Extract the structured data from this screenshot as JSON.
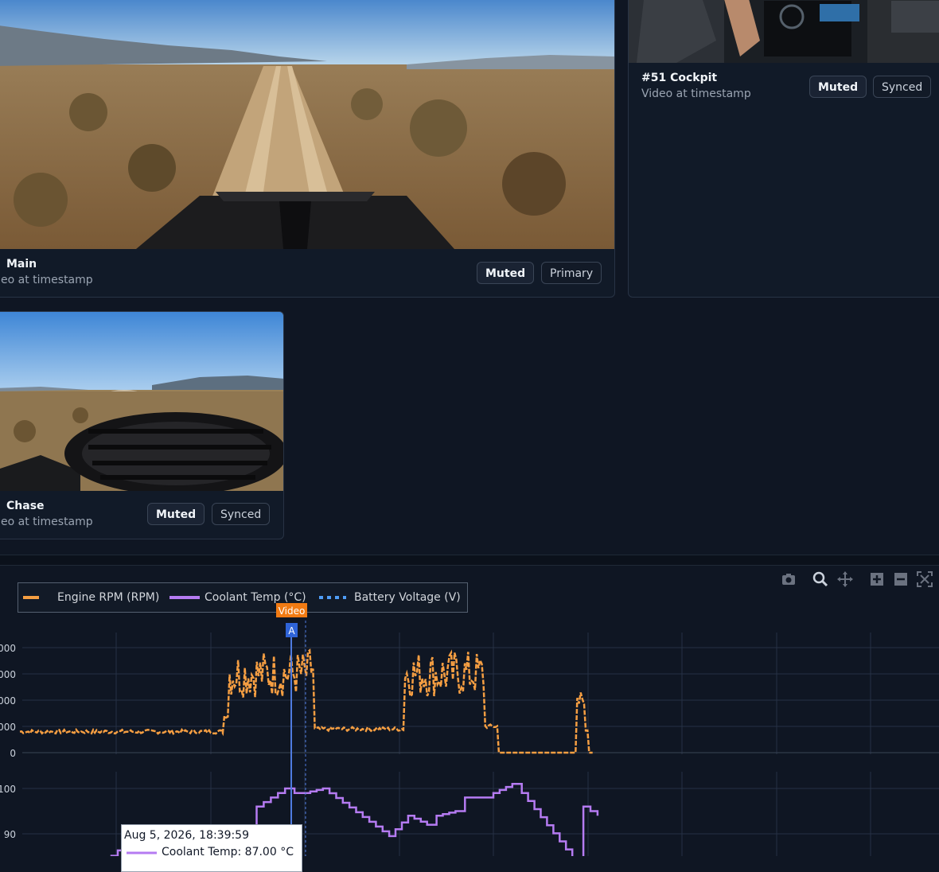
{
  "cameras": [
    {
      "title": "Main",
      "subtitle": "eo at timestamp",
      "badges": [
        "Muted",
        "Primary"
      ]
    },
    {
      "title": "#51 Cockpit",
      "subtitle": "Video at timestamp",
      "badges": [
        "Muted",
        "Synced"
      ]
    },
    {
      "title": "Chase",
      "subtitle": "eo at timestamp",
      "badges": [
        "Muted",
        "Synced"
      ]
    }
  ],
  "chart": {
    "legend": [
      {
        "name": "Engine RPM (RPM)",
        "color": "#f59e42",
        "style": "dashed"
      },
      {
        "name": "Coolant Temp (°C)",
        "color": "#b57bf2",
        "style": "solid"
      },
      {
        "name": "Battery Voltage (V)",
        "color": "#4f9cf5",
        "style": "dotted"
      }
    ],
    "video_marker_label": "Video",
    "cursor_marker_label": "A",
    "toolbar_icons": [
      "camera-icon",
      "zoom-icon",
      "pan-icon",
      "zoom-in-icon",
      "zoom-out-icon",
      "reset-axes-icon"
    ],
    "tooltip": {
      "time": "Aug 5, 2026, 18:39:59",
      "series": "Coolant Temp: 87.00 °C"
    }
  },
  "chart_data": [
    {
      "type": "line",
      "series": [
        {
          "name": "Engine RPM (RPM)",
          "color": "#f59e42"
        }
      ],
      "ytick_labels": [
        "000",
        "000",
        "000",
        "000",
        "0"
      ],
      "y_ticks": [
        4,
        3,
        2,
        1,
        0
      ],
      "profile": [
        [
          0,
          0.8
        ],
        [
          21,
          0.8
        ],
        [
          21.5,
          1.4
        ],
        [
          22,
          3.0
        ],
        [
          30.5,
          3.2
        ],
        [
          31,
          0.9
        ],
        [
          40,
          0.9
        ],
        [
          40.5,
          3.0
        ],
        [
          48.5,
          3.0
        ],
        [
          49,
          1.0
        ],
        [
          50.5,
          0
        ],
        [
          58.5,
          0
        ],
        [
          59,
          2.2
        ],
        [
          59.5,
          0.9
        ],
        [
          60,
          0
        ],
        [
          60.5,
          0
        ]
      ]
    },
    {
      "type": "line",
      "series": [
        {
          "name": "Coolant Temp (°C)",
          "color": "#b57bf2"
        }
      ],
      "ytick_labels": [
        "100",
        "90"
      ],
      "y_ticks": [
        100,
        90
      ],
      "points": [
        [
          0,
          84
        ],
        [
          9,
          84
        ],
        [
          11,
          87.5
        ],
        [
          20,
          89
        ],
        [
          21,
          91
        ],
        [
          24,
          91
        ],
        [
          25,
          96
        ],
        [
          28,
          100
        ],
        [
          29,
          99
        ],
        [
          30,
          99
        ],
        [
          32,
          100
        ],
        [
          39,
          89.5
        ],
        [
          41,
          94
        ],
        [
          43,
          92
        ],
        [
          44,
          94
        ],
        [
          46,
          95
        ],
        [
          47,
          98
        ],
        [
          49,
          98
        ],
        [
          50,
          99
        ],
        [
          52,
          101
        ],
        [
          53,
          99
        ],
        [
          59,
          83
        ],
        [
          59.5,
          96
        ],
        [
          61,
          94
        ]
      ]
    }
  ]
}
